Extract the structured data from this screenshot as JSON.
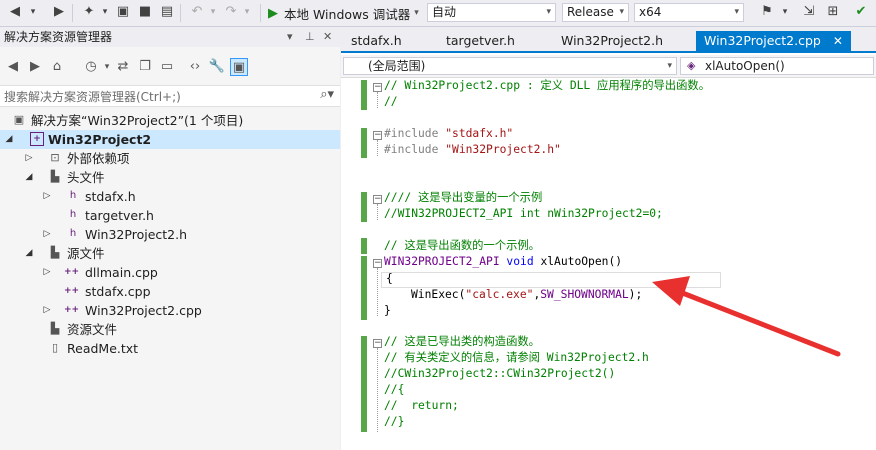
{
  "toolbar": {
    "run_label": "本地 Windows 调试器",
    "config_value": "自动",
    "build_value": "Release",
    "platform_value": "x64"
  },
  "explorer": {
    "title": "解决方案资源管理器",
    "search_placeholder": "搜索解决方案资源管理器(Ctrl+;)",
    "tree": [
      {
        "label": "解决方案“Win32Project2”(1 个项目)",
        "icon": "solution-icon"
      },
      {
        "label": "Win32Project2",
        "icon": "project-icon",
        "selected": true
      },
      {
        "label": "外部依赖项",
        "icon": "external-deps-icon"
      },
      {
        "label": "头文件",
        "icon": "folder-icon"
      },
      {
        "label": "stdafx.h",
        "icon": "header-file-icon"
      },
      {
        "label": "targetver.h",
        "icon": "header-file-icon"
      },
      {
        "label": "Win32Project2.h",
        "icon": "header-file-icon"
      },
      {
        "label": "源文件",
        "icon": "folder-icon"
      },
      {
        "label": "dllmain.cpp",
        "icon": "cpp-file-icon"
      },
      {
        "label": "stdafx.cpp",
        "icon": "cpp-file-icon"
      },
      {
        "label": "Win32Project2.cpp",
        "icon": "cpp-file-icon"
      },
      {
        "label": "资源文件",
        "icon": "folder-icon"
      },
      {
        "label": "ReadMe.txt",
        "icon": "text-file-icon"
      }
    ]
  },
  "editor": {
    "tabs": [
      "stdafx.h",
      "targetver.h",
      "Win32Project2.h",
      "Win32Project2.cpp"
    ],
    "active_tab": "Win32Project2.cpp",
    "scope_value": "(全局范围)",
    "function_value": "xlAutoOpen()",
    "code": {
      "l1": "// Win32Project2.cpp : 定义 DLL 应用程序的导出函数。",
      "l2": "//",
      "l3a": "#include ",
      "l3b": "\"stdafx.h\"",
      "l4a": "#include ",
      "l4b": "\"Win32Project2.h\"",
      "l5": "//// 这是导出变量的一个示例",
      "l6": "//WIN32PROJECT2_API int nWin32Project2=0;",
      "l7": "// 这是导出函数的一个示例。",
      "l8a": "WIN32PROJECT2_API",
      "l8b": " void ",
      "l8c": "xlAutoOpen()",
      "l9": "{",
      "l10a": "WinExec(",
      "l10b": "\"calc.exe\"",
      "l10c": ",",
      "l10d": "SW_SHOWNORMAL",
      "l10e": ");",
      "l11": "}",
      "l12": "// 这是已导出类的构造函数。",
      "l13": "// 有关类定义的信息，请参阅 Win32Project2.h",
      "l14": "//CWin32Project2::CWin32Project2()",
      "l15": "//{",
      "l16": "//  return;",
      "l17": "//}"
    }
  },
  "colors": {
    "accent": "#007acc",
    "selection": "#cce8ff",
    "annotation_arrow": "#e8312f"
  }
}
